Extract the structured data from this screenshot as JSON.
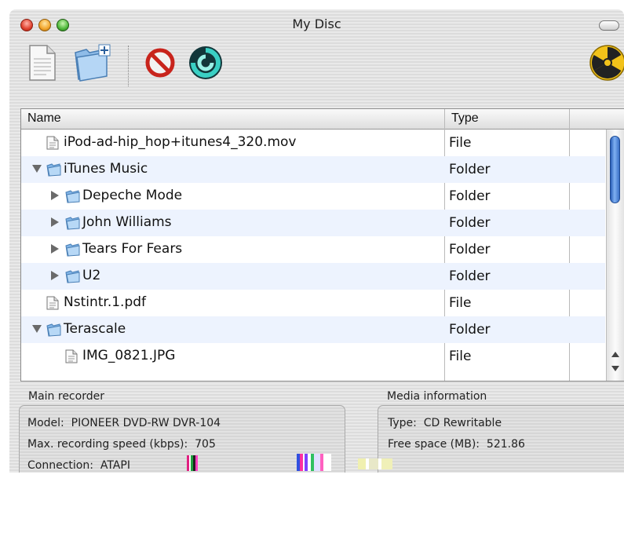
{
  "window": {
    "title": "My Disc"
  },
  "toolbar": {
    "buttons": [
      {
        "name": "new-file-icon"
      },
      {
        "name": "new-folder-icon"
      },
      {
        "name": "delete-icon"
      },
      {
        "name": "burn-swirl-icon"
      },
      {
        "name": "burn-radiation-icon"
      }
    ]
  },
  "file_list": {
    "columns": [
      "Name",
      "Type"
    ],
    "rows": [
      {
        "name": "iPod-ad-hip_hop+itunes4_320.mov",
        "type": "File",
        "kind": "file",
        "level": 0,
        "disclosure": "none"
      },
      {
        "name": "iTunes Music",
        "type": "Folder",
        "kind": "folder",
        "level": 0,
        "disclosure": "expanded"
      },
      {
        "name": "Depeche Mode",
        "type": "Folder",
        "kind": "folder",
        "level": 1,
        "disclosure": "collapsed"
      },
      {
        "name": "John Williams",
        "type": "Folder",
        "kind": "folder",
        "level": 1,
        "disclosure": "collapsed"
      },
      {
        "name": "Tears For Fears",
        "type": "Folder",
        "kind": "folder",
        "level": 1,
        "disclosure": "collapsed"
      },
      {
        "name": "U2",
        "type": "Folder",
        "kind": "folder",
        "level": 1,
        "disclosure": "collapsed"
      },
      {
        "name": "Nstintr.1.pdf",
        "type": "File",
        "kind": "file",
        "level": 0,
        "disclosure": "none"
      },
      {
        "name": "Terascale",
        "type": "Folder",
        "kind": "folder",
        "level": 0,
        "disclosure": "expanded"
      },
      {
        "name": "IMG_0821.JPG",
        "type": "File",
        "kind": "file",
        "level": 1,
        "disclosure": "none"
      }
    ]
  },
  "main_recorder": {
    "label": "Main recorder",
    "model_label": "Model:",
    "model_value": "PIONEER DVD-RW DVR-104",
    "speed_label": "Max. recording speed (kbps):",
    "speed_value": "705",
    "connection_label": "Connection:",
    "connection_value": "ATAPI"
  },
  "media_info": {
    "label": "Media information",
    "type_label": "Type:",
    "type_value": "CD Rewritable",
    "free_label": "Free space (MB):",
    "free_value": "521.86"
  },
  "colors": {
    "row_alt": "#edf3fe",
    "scroll_thumb": "#3a70c8",
    "close": "#e0412e",
    "minimize": "#f2a52b",
    "zoom": "#4eb83a"
  }
}
